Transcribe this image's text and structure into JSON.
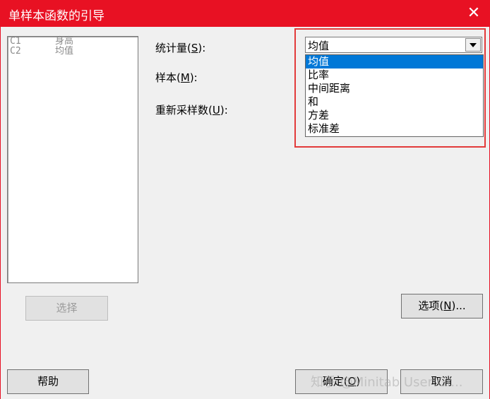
{
  "window": {
    "title": "单样本函数的引导",
    "close_glyph": "✕"
  },
  "variables": [
    {
      "col": "C1",
      "name": "身高"
    },
    {
      "col": "C2",
      "name": "均值"
    }
  ],
  "fields": {
    "statistic": {
      "label_pre": "统计量(",
      "accel": "S",
      "label_post": "):",
      "value": "均值"
    },
    "sample": {
      "label_pre": "样本(",
      "accel": "M",
      "label_post": "):"
    },
    "resample": {
      "label_pre": "重新采样数(",
      "accel": "U",
      "label_post": "):"
    }
  },
  "dropdown_options": [
    "均值",
    "比率",
    "中间距离",
    "和",
    "方差",
    "标准差"
  ],
  "dropdown_selected": "均值",
  "buttons": {
    "select": "选择",
    "options_pre": "选项(",
    "options_accel": "N",
    "options_post": ")...",
    "help": "帮助",
    "ok_pre": "确定(",
    "ok_accel": "O",
    "ok_post": ")",
    "cancel": "取消"
  },
  "watermark": "知乎 @Minitab User Gr...",
  "colors": {
    "titlebar": "#e81123",
    "selection": "#0078d7",
    "highlight_box": "#e23a3a"
  }
}
